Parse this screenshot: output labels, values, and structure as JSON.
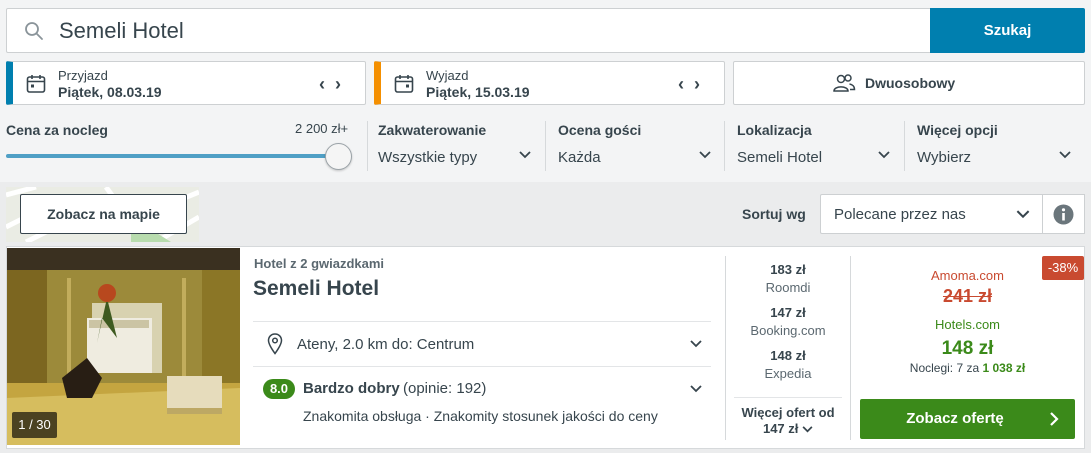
{
  "search": {
    "query": "Semeli Hotel",
    "button_label": "Szukaj"
  },
  "dates": {
    "checkin": {
      "label": "Przyjazd",
      "value": "Piątek, 08.03.19",
      "accent": "#007faf"
    },
    "checkout": {
      "label": "Wyjazd",
      "value": "Piątek, 15.03.19",
      "accent": "#f48f00"
    }
  },
  "room": {
    "label": "Dwuosobowy",
    "icon": "people-icon"
  },
  "filters": {
    "price": {
      "label": "Cena za nocleg",
      "max_label": "2 200 zł+",
      "slider_level": 1.0
    },
    "accommodation": {
      "label": "Zakwaterowanie",
      "value": "Wszystkie typy"
    },
    "guest_rating": {
      "label": "Ocena gości",
      "value": "Każda"
    },
    "location": {
      "label": "Lokalizacja",
      "value": "Semeli Hotel"
    },
    "more": {
      "label": "Więcej opcji",
      "value": "Wybierz"
    }
  },
  "map_button": {
    "label": "Zobacz na mapie"
  },
  "sort": {
    "label": "Sortuj wg",
    "value": "Polecane przez nas"
  },
  "hotel": {
    "photo_counter": "1 / 30",
    "stars_text": "Hotel z 2 gwiazdkami",
    "name": "Semeli Hotel",
    "location": "Ateny, 2.0 km do: Centrum",
    "rating": {
      "score": "8.0",
      "word": "Bardzo dobry",
      "count": "(opinie: 192)",
      "highlights": "Znakomita obsługa · Znakomity stosunek jakości do ceny",
      "color": "#3b8a1a"
    },
    "alt_offers": [
      {
        "price": "183 zł",
        "site": "Roomdi"
      },
      {
        "price": "147 zł",
        "site": "Booking.com"
      },
      {
        "price": "148 zł",
        "site": "Expedia"
      }
    ],
    "more_offers": {
      "line1": "Więcej ofert od",
      "line2": "147 zł"
    },
    "deal": {
      "discount": "-38%",
      "orig_site": "Amoma.com",
      "orig_price": "241 zł",
      "best_site": "Hotels.com",
      "best_price": "148 zł",
      "nights_prefix": "Noclegi: 7 za",
      "nights_total": "1 038 zł",
      "cta": "Zobacz ofertę"
    }
  }
}
